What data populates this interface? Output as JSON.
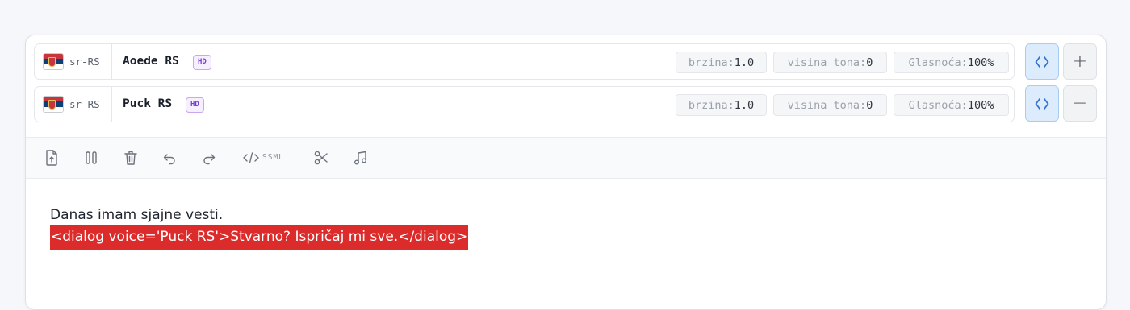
{
  "voices": [
    {
      "lang": "sr-RS",
      "name": "Aoede RS",
      "badge": "HD",
      "params": [
        {
          "key": "brzina:",
          "value": "1.0"
        },
        {
          "key": "visina tona:",
          "value": "0"
        },
        {
          "key": "Glasnoća:",
          "value": "100%"
        }
      ],
      "code_icon": "code-brackets-icon",
      "action": "+",
      "action_icon": "plus-icon"
    },
    {
      "lang": "sr-RS",
      "name": "Puck RS",
      "badge": "HD",
      "params": [
        {
          "key": "brzina:",
          "value": "1.0"
        },
        {
          "key": "visina tona:",
          "value": "0"
        },
        {
          "key": "Glasnoća:",
          "value": "100%"
        }
      ],
      "code_icon": "code-brackets-icon",
      "action": "−",
      "action_icon": "minus-icon"
    }
  ],
  "toolbar": {
    "icons": [
      "upload-file-icon",
      "pause-icon",
      "trash-icon",
      "undo-icon",
      "redo-icon",
      "ssml-code-icon",
      "scissors-icon",
      "music-note-icon"
    ],
    "ssml_label": "SSML"
  },
  "editor": {
    "line1": "Danas imam sjajne vesti.",
    "line2": "<dialog voice='Puck RS'>Stvarno? Ispričaj mi sve.</dialog>",
    "highlight_color": "#dc2b2b"
  },
  "colors": {
    "accent": "#2f74d0",
    "hd_badge": "#7a3fd1"
  }
}
